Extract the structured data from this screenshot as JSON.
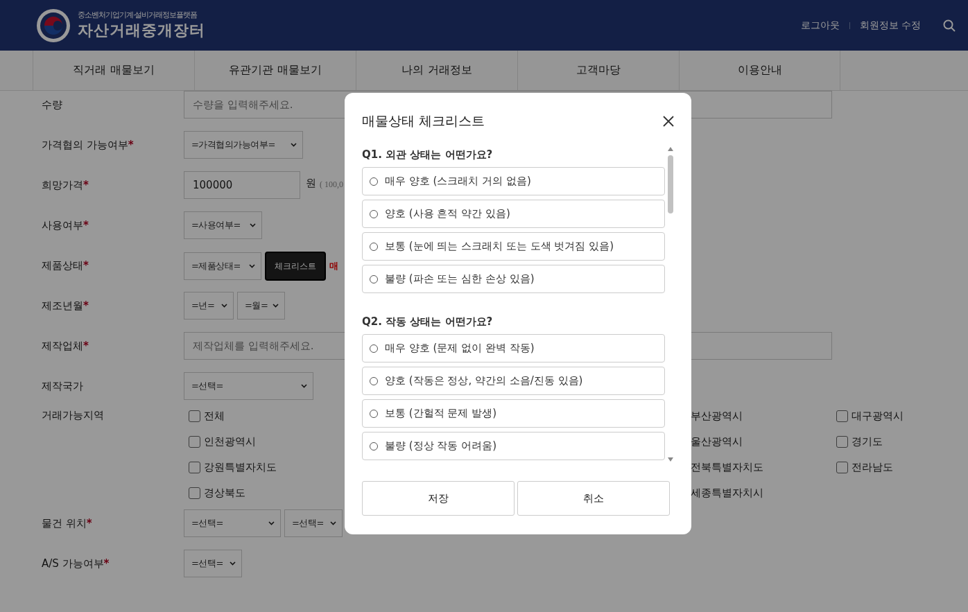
{
  "header": {
    "subtitle": "중소벤처기업기계·설비거래정보플랫폼",
    "title": "자산거래중개장터",
    "links": [
      {
        "label": "로그아웃"
      },
      {
        "label": "회원정보 수정"
      }
    ]
  },
  "nav": [
    {
      "label": "직거래 매물보기"
    },
    {
      "label": "유관기관 매물보기"
    },
    {
      "label": "나의 거래정보"
    },
    {
      "label": "고객마당"
    },
    {
      "label": "이용안내"
    }
  ],
  "form": [
    {
      "kind": "input",
      "label": "수량",
      "placeholder": "수량을 입력해주세요."
    },
    {
      "kind": "selects",
      "label": "가격협의 가능여부",
      "mark": "*",
      "selects": [
        "=가격협의가능여부="
      ]
    },
    {
      "kind": "price",
      "label": "희망가격",
      "mark": "*",
      "value": "100000",
      "unit": "원",
      "note": "( 100,0"
    },
    {
      "kind": "selects",
      "label": "사용여부",
      "mark": "*",
      "selects": [
        "=사용여부="
      ]
    },
    {
      "kind": "selects",
      "label": "제품상태",
      "mark": "*",
      "selects": [
        "=제품상태="
      ],
      "button": "체크리스트",
      "warning": "매"
    },
    {
      "kind": "selects",
      "label": "제조년월",
      "mark": "*",
      "selects": [
        "=년=",
        "=월="
      ]
    },
    {
      "kind": "input",
      "label": "제작업체",
      "mark": "*",
      "placeholder": "제작업체를 입력해주세요."
    },
    {
      "kind": "selects",
      "label": "제작국가",
      "selects": [
        "=선택="
      ]
    },
    {
      "kind": "regions",
      "label": "거래가능지역",
      "regions": [
        [
          {
            "label": "전체",
            "checked": false
          },
          {
            "label": "부산광역시"
          },
          {
            "label": "대구광역시",
            "checked": false
          }
        ],
        [
          {
            "label": "인천광역시",
            "checked": false
          },
          {
            "label": "울산광역시"
          },
          {
            "label": "경기도",
            "checked": false
          }
        ],
        [
          {
            "label": "강원특별자치도",
            "checked": false
          },
          {
            "label": "전북특별자치도"
          },
          {
            "label": "전라남도",
            "checked": false
          }
        ],
        [
          {
            "label": "경상북도",
            "checked": false
          },
          {
            "label": "세종특별자치시"
          }
        ]
      ]
    },
    {
      "kind": "selects",
      "label": "물건 위치",
      "mark": "*",
      "selects": [
        "=선택=",
        "=선택="
      ]
    },
    {
      "kind": "selects",
      "label": "A/S 가능여부",
      "mark": "*",
      "selects": [
        "=선택="
      ]
    }
  ],
  "modal": {
    "title": "매물상태 체크리스트",
    "questions": [
      {
        "title": "Q1. 외관 상태는 어떤가요?",
        "options": [
          {
            "label": "매우 양호 (스크래치 거의 없음)",
            "selected": false
          },
          {
            "label": "양호 (사용 흔적 약간 있음)",
            "selected": false
          },
          {
            "label": "보통 (눈에 띄는 스크래치 또는 도색 벗겨짐 있음)",
            "selected": false
          },
          {
            "label": "불량 (파손 또는 심한 손상 있음)",
            "selected": false
          }
        ]
      },
      {
        "title": "Q2. 작동 상태는 어떤가요?",
        "options": [
          {
            "label": "매우 양호 (문제 없이 완벽 작동)",
            "selected": false
          },
          {
            "label": "양호 (작동은 정상, 약간의 소음/진동 있음)",
            "selected": false
          },
          {
            "label": "보통 (간헐적 문제 발생)",
            "selected": false
          },
          {
            "label": "불량 (정상 작동 어려움)",
            "selected": false
          }
        ]
      }
    ],
    "buttons": [
      "저장",
      "취소"
    ]
  }
}
